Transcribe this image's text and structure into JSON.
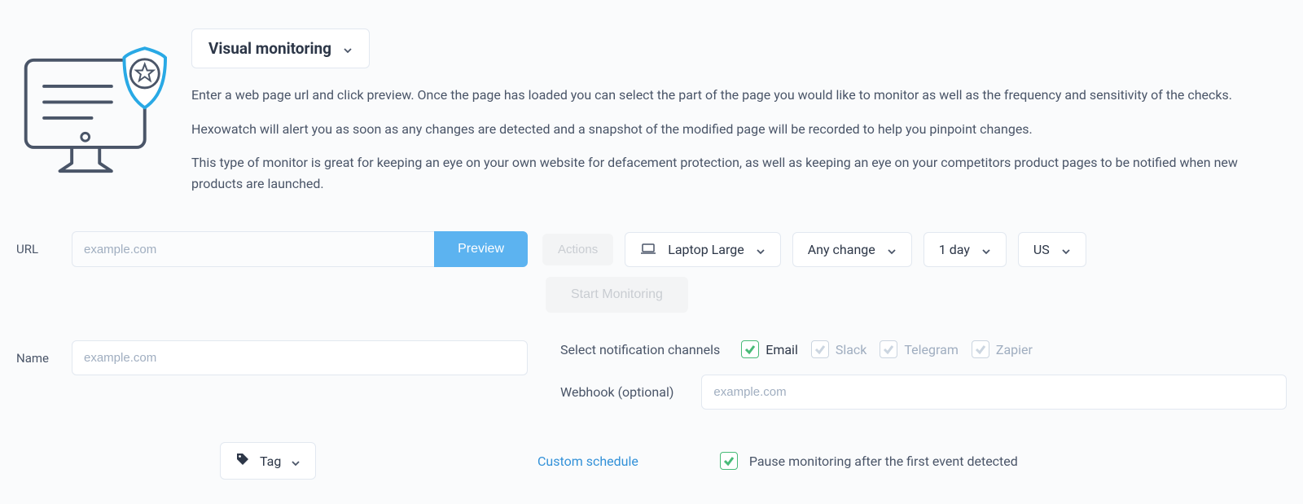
{
  "header": {
    "monitor_type": "Visual monitoring",
    "paragraphs": [
      "Enter a web page url and click preview. Once the page has loaded you can select the part of the page you would like to monitor as well as the frequency and sensitivity of the checks.",
      "Hexowatch will alert you as soon as any changes are detected and a snapshot of the modified page will be recorded to help you pinpoint changes.",
      "This type of monitor is great for keeping an eye on your own website for defacement protection, as well as keeping an eye on your competitors product pages to be notified when new products are launched."
    ]
  },
  "form": {
    "url_label": "URL",
    "url_placeholder": "example.com",
    "preview_label": "Preview",
    "actions_label": "Actions",
    "device_label": "Laptop Large",
    "sensitivity_label": "Any change",
    "frequency_label": "1 day",
    "region_label": "US",
    "start_label": "Start Monitoring",
    "name_label": "Name",
    "name_placeholder": "example.com",
    "notif_label": "Select notification channels",
    "channels": {
      "email": "Email",
      "slack": "Slack",
      "telegram": "Telegram",
      "zapier": "Zapier"
    },
    "webhook_label": "Webhook (optional)",
    "webhook_placeholder": "example.com",
    "tag_label": "Tag",
    "custom_schedule": "Custom schedule",
    "pause_label": "Pause monitoring after the first event detected"
  }
}
